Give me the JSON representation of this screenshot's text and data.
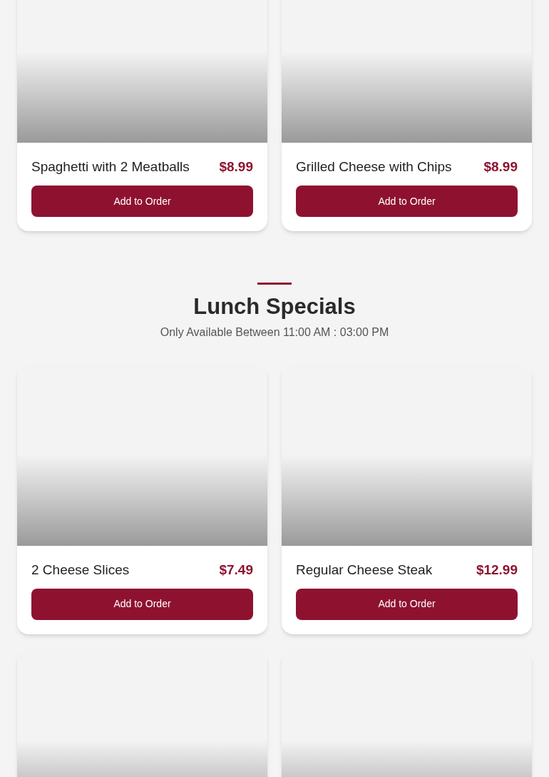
{
  "sections": [
    {
      "items": [
        {
          "kind": "full",
          "name": "Spaghetti with 2 Meatballs",
          "price": "$8.99",
          "button": "Add to Order"
        },
        {
          "kind": "full",
          "name": "Grilled Cheese with Chips",
          "price": "$8.99",
          "button": "Add to Order"
        }
      ]
    },
    {
      "title": "Lunch Specials",
      "subtitle": "Only Available Between 11:00 AM : 03:00 PM",
      "items": [
        {
          "kind": "full",
          "name": "2 Cheese Slices",
          "price": "$7.49",
          "button": "Add to Order"
        },
        {
          "kind": "full",
          "name": "Regular Cheese Steak",
          "price": "$12.99",
          "button": "Add to Order"
        },
        {
          "kind": "partial"
        },
        {
          "kind": "partial"
        }
      ]
    }
  ]
}
